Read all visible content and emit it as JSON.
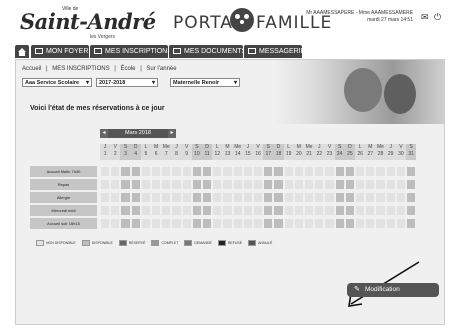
{
  "header": {
    "logo": {
      "ville": "Ville de",
      "name": "Saint-André",
      "sub": "les Vergers"
    },
    "portail": "PORTAIL",
    "famille": "FAMILLE",
    "user_name": "Mr AAAMESSAPERE - Mme AAAMESSAMERE",
    "user_date": "mardi 27 mars 14:51",
    "icons": [
      "mail-icon",
      "logout-icon"
    ]
  },
  "nav": {
    "home_icon": "home-icon",
    "tabs": [
      {
        "label": "MON FOYER",
        "icon": "home-icon"
      },
      {
        "label": "MES INSCRIPTIONS",
        "icon": "list-icon"
      },
      {
        "label": "MES DOCUMENTS",
        "icon": "folder-icon"
      },
      {
        "label": "MESSAGERIE",
        "icon": "mail-icon"
      }
    ]
  },
  "breadcrumb": [
    "Accueil",
    "|",
    "MES INSCRIPTIONS",
    "|",
    "École",
    "|",
    "Sur l'année"
  ],
  "filters": {
    "service": "Aaa Service Scolaire",
    "year": "2017-2018",
    "school": "Maternelle Renoir"
  },
  "title": "Voici l'état de mes réservations à ce jour",
  "calendar": {
    "month": "Mars 2018",
    "prev": "◂",
    "next": "▸",
    "day_letters": [
      "J",
      "V",
      "S",
      "D",
      "L",
      "M",
      "Me",
      "J",
      "V",
      "S",
      "D",
      "L",
      "M",
      "Me",
      "J",
      "V",
      "S",
      "D",
      "L",
      "M",
      "Me",
      "J",
      "V",
      "S",
      "D",
      "L",
      "M",
      "Me",
      "J",
      "V",
      "S"
    ],
    "day_numbers": [
      "1",
      "2",
      "3",
      "4",
      "5",
      "6",
      "7",
      "8",
      "9",
      "10",
      "11",
      "12",
      "13",
      "14",
      "15",
      "16",
      "17",
      "18",
      "19",
      "20",
      "21",
      "22",
      "23",
      "24",
      "25",
      "26",
      "27",
      "28",
      "29",
      "30",
      "31"
    ],
    "rows": [
      "Accueil Matin 7h30",
      "Repas",
      "Allergie",
      "Mercredi midi",
      "Accueil soir 16h15"
    ]
  },
  "legend": [
    {
      "label": "NON DISPONIBLE",
      "color": "#e2e2e2"
    },
    {
      "label": "DISPONIBLE",
      "color": "#bdbdbd"
    },
    {
      "label": "RÉSERVÉ",
      "color": "#666666"
    },
    {
      "label": "COMPLET",
      "color": "#999999"
    },
    {
      "label": "DEMANDÉ",
      "color": "#777777"
    },
    {
      "label": "REFUSÉ",
      "color": "#222222"
    },
    {
      "label": "ANNULÉ",
      "color": "#555555"
    }
  ],
  "modification_button": "Modification"
}
